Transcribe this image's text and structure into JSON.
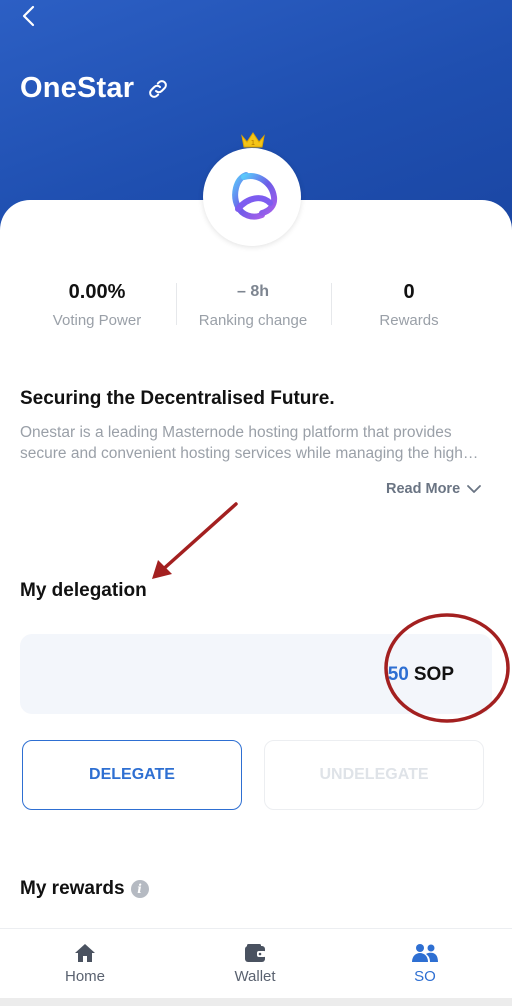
{
  "header": {
    "title": "OneStar",
    "back_icon": "chevron-left-icon",
    "link_icon": "link-icon",
    "gradient_start": "#2c5fc4",
    "gradient_end": "#1a46a3"
  },
  "validator": {
    "rank_badge_icon": "crown-icon",
    "logo": "onestar-logo"
  },
  "stats": [
    {
      "value": "0.00%",
      "label": "Voting Power"
    },
    {
      "value": "– 8h",
      "label": "Ranking change"
    },
    {
      "value": "0",
      "label": "Rewards"
    }
  ],
  "about": {
    "heading": "Securing the Decentralised Future.",
    "line1": "Onestar is a leading Masternode hosting platform that provides",
    "line2": "secure and convenient hosting services while managing the high…",
    "read_more": "Read More"
  },
  "delegation": {
    "heading": "My delegation",
    "amount": "50",
    "unit": "SOP",
    "delegate_label": "DELEGATE",
    "undelegate_label": "UNDELEGATE"
  },
  "rewards": {
    "heading": "My rewards",
    "info_icon": "i"
  },
  "tabs": [
    {
      "label": "Home",
      "icon": "home-icon"
    },
    {
      "label": "Wallet",
      "icon": "wallet-icon"
    },
    {
      "label": "SO",
      "icon": "users-icon",
      "active": true
    }
  ],
  "colors": {
    "accent": "#2e6fd2",
    "annotation": "#a32020"
  }
}
